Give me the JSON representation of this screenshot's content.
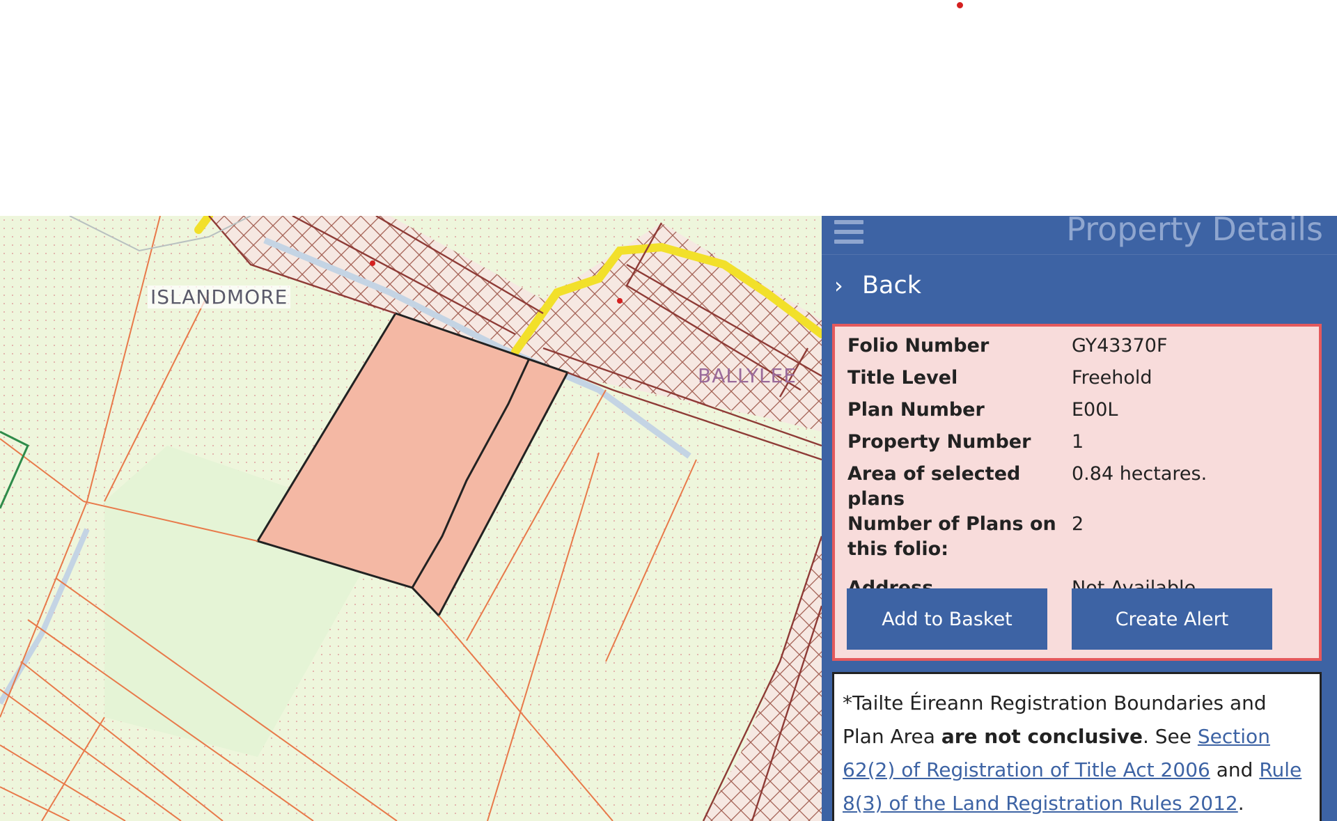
{
  "panel": {
    "title": "Property Details",
    "menu_icon": "hamburger-icon",
    "back_label": "Back",
    "back_icon": "chevron-right-icon"
  },
  "map": {
    "labels": [
      "ISLANDMORE",
      "BALLYLEE"
    ]
  },
  "details": {
    "rows": [
      {
        "label": "Folio Number",
        "value": "GY43370F"
      },
      {
        "label": "Title Level",
        "value": "Freehold"
      },
      {
        "label": "Plan Number",
        "value": "E00L"
      },
      {
        "label": "Property Number",
        "value": "1"
      },
      {
        "label": "Area of selected plans",
        "value": "0.84 hectares."
      },
      {
        "label": "Number of Plans on this folio:",
        "value": "2"
      },
      {
        "label": "Address",
        "value": "Not Available"
      }
    ],
    "add_to_basket": "Add to Basket",
    "create_alert": "Create Alert"
  },
  "disclaimer": {
    "prefix": "*Tailte Éireann Registration Boundaries and Plan Area ",
    "bold": "are not conclusive",
    "mid": ". See ",
    "link1": "Section 62(2) of Registration of Title Act 2006",
    "and": " and ",
    "link2": "Rule 8(3) of the Land Registration Rules 2012",
    "end": "."
  },
  "colors": {
    "panel_bg": "#3d63a4",
    "selected_parcel": "#f4b8a4",
    "details_bg": "#f8dcdb",
    "details_border": "#e4595c",
    "road": "#f2e02a",
    "boundary": "#8e3b36"
  }
}
